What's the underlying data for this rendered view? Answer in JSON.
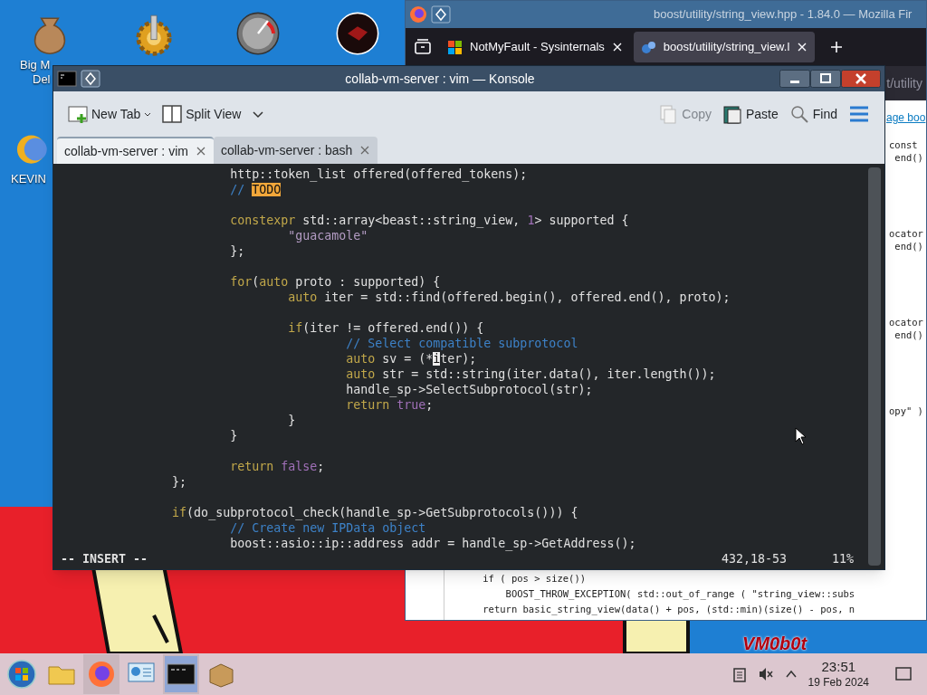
{
  "desktop": {
    "icons": [
      {
        "kind": "money",
        "label": [
          "Big M",
          "Del"
        ]
      },
      {
        "kind": "gear"
      },
      {
        "kind": "gauge"
      },
      {
        "kind": "disc"
      },
      {
        "kind": "sun",
        "label": [
          "KEVIN"
        ]
      }
    ],
    "wallpaper_text": "VM0b0t"
  },
  "browser": {
    "title": "boost/utility/string_view.hpp - 1.84.0 — Mozilla Fir",
    "tabs": [
      {
        "label": "NotMyFault - Sysinternals",
        "selected": false
      },
      {
        "label": "boost/utility/string_view.l",
        "selected": true
      }
    ],
    "url": "t/utility",
    "link": "age boo",
    "side_code": [
      {
        "text": "const"
      },
      {
        "text": " end()"
      },
      {
        "kind": "gap"
      },
      {
        "text": "ocator"
      },
      {
        "text": " end()"
      },
      {
        "kind": "gap"
      },
      {
        "text": "ocator"
      },
      {
        "text": " end()"
      },
      {
        "kind": "gap"
      },
      {
        "text": "opy\" )"
      }
    ],
    "bottom_code": [
      "    if ( pos > size())",
      "        BOOST_THROW_EXCEPTION( std::out_of_range ( \"string_view::subs",
      "    return basic_string_view(data() + pos, (std::min)(size() - pos, n"
    ]
  },
  "konsole": {
    "title": "collab-vm-server : vim — Konsole",
    "toolbar": [
      {
        "kind": "new-tab",
        "label": "New Tab",
        "disabled": false
      },
      {
        "kind": "split",
        "label": "Split View",
        "disabled": false
      },
      {
        "kind": "copy",
        "label": "Copy",
        "disabled": true
      },
      {
        "kind": "paste",
        "label": "Paste",
        "disabled": false
      },
      {
        "kind": "find",
        "label": "Find",
        "disabled": false
      }
    ],
    "tabs": [
      {
        "label": "collab-vm-server : vim",
        "selected": true
      },
      {
        "label": "collab-vm-server : bash",
        "selected": false
      }
    ],
    "lines": [
      {
        "segments": [
          {
            "kind": "plain",
            "text": "                        http::token_list offered(offered_tokens);"
          }
        ]
      },
      {
        "segments": [
          {
            "kind": "comment",
            "text": "                        // "
          },
          {
            "kind": "todo",
            "text": "TODO"
          }
        ]
      },
      {
        "kind": "blank"
      },
      {
        "segments": [
          {
            "kind": "keyword",
            "text": "                        constexpr"
          },
          {
            "kind": "plain",
            "text": " std::array<beast::string_view, "
          },
          {
            "kind": "number",
            "text": "1"
          },
          {
            "kind": "plain",
            "text": "> supported {"
          }
        ]
      },
      {
        "segments": [
          {
            "kind": "string",
            "text": "                                \"guacamole\""
          }
        ]
      },
      {
        "segments": [
          {
            "kind": "plain",
            "text": "                        };"
          }
        ]
      },
      {
        "kind": "blank"
      },
      {
        "segments": [
          {
            "kind": "keyword",
            "text": "                        for"
          },
          {
            "kind": "plain",
            "text": "("
          },
          {
            "kind": "keyword",
            "text": "auto"
          },
          {
            "kind": "plain",
            "text": " proto : supported) {"
          }
        ]
      },
      {
        "segments": [
          {
            "kind": "keyword",
            "text": "                                auto"
          },
          {
            "kind": "plain",
            "text": " iter = std::find(offered.begin(), offered.end(), proto);"
          }
        ]
      },
      {
        "kind": "blank"
      },
      {
        "segments": [
          {
            "kind": "keyword",
            "text": "                                if"
          },
          {
            "kind": "plain",
            "text": "(iter != offered.end()) {"
          }
        ]
      },
      {
        "segments": [
          {
            "kind": "comment",
            "text": "                                        // Select compatible subprotocol"
          }
        ]
      },
      {
        "segments": [
          {
            "kind": "keyword",
            "text": "                                        auto"
          },
          {
            "kind": "plain",
            "text": " sv = (*"
          },
          {
            "kind": "cursor",
            "text": "i"
          },
          {
            "kind": "plain",
            "text": "ter);"
          }
        ]
      },
      {
        "segments": [
          {
            "kind": "keyword",
            "text": "                                        auto"
          },
          {
            "kind": "plain",
            "text": " str = std::string(iter.data(), iter.length());"
          }
        ]
      },
      {
        "segments": [
          {
            "kind": "plain",
            "text": "                                        handle_sp->SelectSubprotocol(str);"
          }
        ]
      },
      {
        "segments": [
          {
            "kind": "keyword",
            "text": "                                        return"
          },
          {
            "kind": "number",
            "text": " true"
          },
          {
            "kind": "plain",
            "text": ";"
          }
        ]
      },
      {
        "segments": [
          {
            "kind": "plain",
            "text": "                                }"
          }
        ]
      },
      {
        "segments": [
          {
            "kind": "plain",
            "text": "                        }"
          }
        ]
      },
      {
        "kind": "blank"
      },
      {
        "segments": [
          {
            "kind": "keyword",
            "text": "                        return"
          },
          {
            "kind": "number",
            "text": " false"
          },
          {
            "kind": "plain",
            "text": ";"
          }
        ]
      },
      {
        "segments": [
          {
            "kind": "plain",
            "text": "                };"
          }
        ]
      },
      {
        "kind": "blank"
      },
      {
        "segments": [
          {
            "kind": "keyword",
            "text": "                if"
          },
          {
            "kind": "plain",
            "text": "(do_subprotocol_check(handle_sp->GetSubprotocols())) {"
          }
        ]
      },
      {
        "segments": [
          {
            "kind": "comment",
            "text": "                        // Create new IPData object"
          }
        ]
      },
      {
        "segments": [
          {
            "kind": "plain",
            "text": "                        boost::asio::ip::address addr = handle_sp->GetAddress();"
          }
        ]
      }
    ],
    "status": {
      "mode": "-- INSERT --",
      "position": "432,18-53",
      "percent": "11%"
    }
  },
  "taskbar": {
    "apps": [
      {
        "kind": "start",
        "open": false,
        "active": false
      },
      {
        "kind": "folder",
        "open": false,
        "active": false
      },
      {
        "kind": "firefox",
        "open": true,
        "active": false
      },
      {
        "kind": "panel",
        "open": false,
        "active": false
      },
      {
        "kind": "terminal",
        "open": true,
        "active": true
      },
      {
        "kind": "package",
        "open": false,
        "active": false
      }
    ],
    "clock": {
      "time": "23:51",
      "date": "19 Feb 2024"
    }
  }
}
